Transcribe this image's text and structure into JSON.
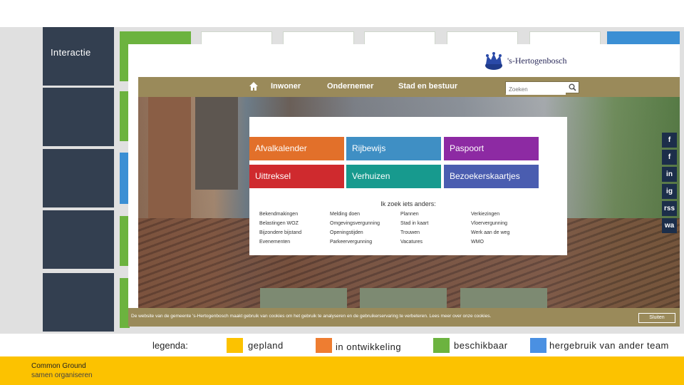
{
  "slide": {
    "left_label": "Interactie"
  },
  "website": {
    "logo_text": "'s-Hertogenbosch",
    "nav": [
      "Inwoner",
      "Ondernemer",
      "Stad en bestuur"
    ],
    "search_placeholder": "Zoeken",
    "buttons": [
      "Afvalkalender",
      "Rijbewijs",
      "Paspoort",
      "Uittreksel",
      "Verhuizen",
      "Bezoekerskaartjes"
    ],
    "panel_heading": "Ik zoek iets anders:",
    "links": [
      [
        "Bekendmakingen",
        "Belastingen WOZ",
        "Bijzondere bijstand",
        "Evenementen"
      ],
      [
        "Melding doen",
        "Omgevingsvergunning",
        "Openingstijden",
        "Parkeervergunning"
      ],
      [
        "Plannen",
        "Stad in kaart",
        "Trouwen",
        "Vacatures"
      ],
      [
        "Verkiezingen",
        "Vloervergunning",
        "Werk aan de weg",
        "WMO"
      ]
    ],
    "social": [
      "f",
      "f",
      "in",
      "ig",
      "rss",
      "wa"
    ],
    "cookie_text": "De website van de gemeente 's-Hertogenbosch maakt gebruik van cookies om het gebruik te analyseren en de gebruikerservaring te verbeteren. Lees meer over onze cookies.",
    "cookie_button": "Sluiten"
  },
  "legend": {
    "label": "legenda:",
    "items": [
      {
        "label": "gepland",
        "color": "#fcc200"
      },
      {
        "label": "in ontwikkeling",
        "color": "#ee7d31"
      },
      {
        "label": "beschikbaar",
        "color": "#6cb33f"
      },
      {
        "label": "hergebruik van ander team",
        "color": "#4a90e2"
      }
    ]
  },
  "footer": {
    "title": "Common Ground",
    "subtitle": "samen organiseren"
  }
}
